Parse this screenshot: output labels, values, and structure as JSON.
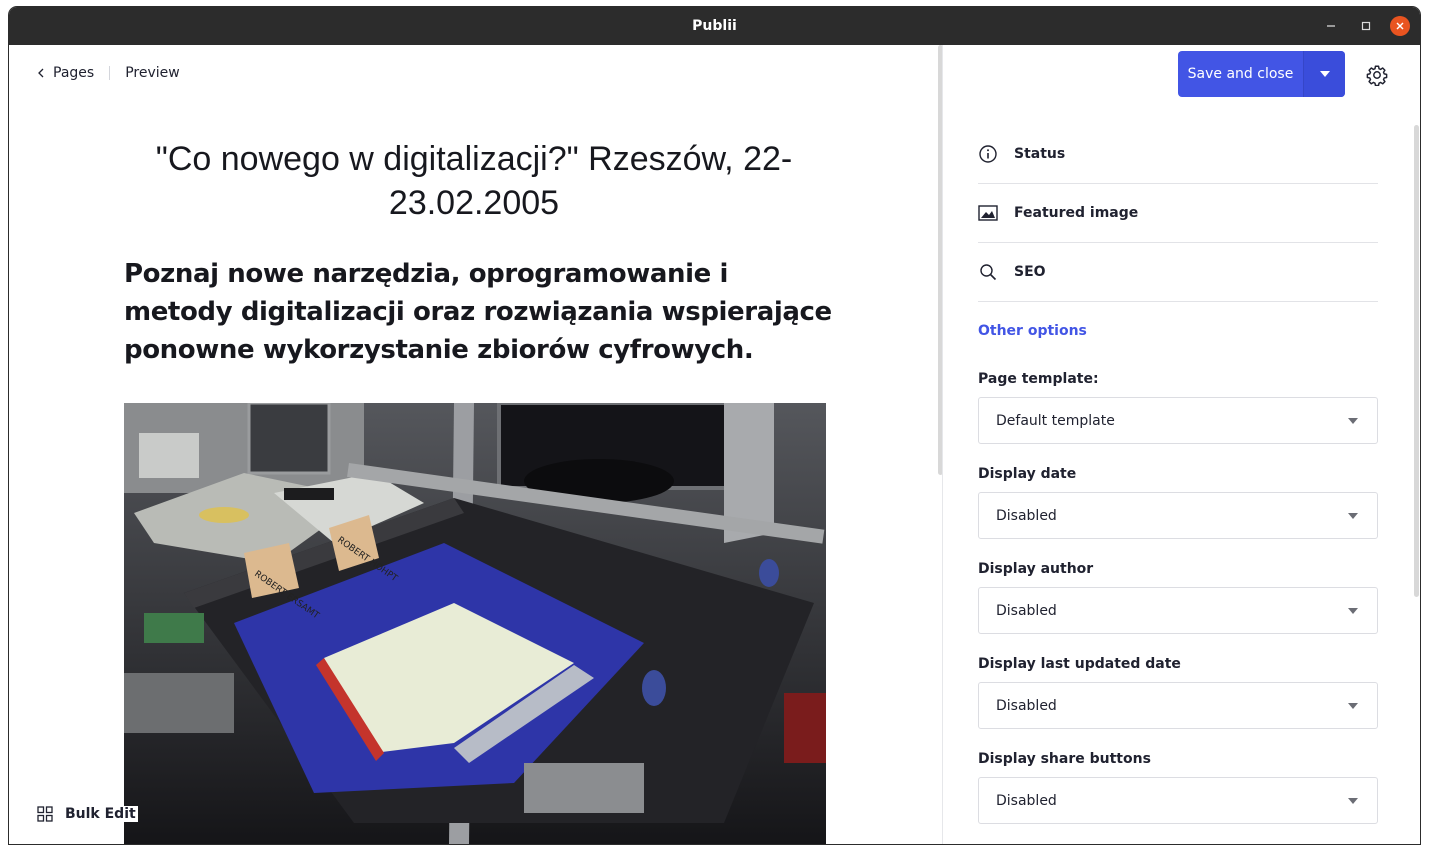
{
  "window": {
    "title": "Publii"
  },
  "nav": {
    "back_label": "Pages",
    "preview_label": "Preview"
  },
  "content": {
    "title": "\"Co nowego w digitalizacji?\" Rzeszów, 22-23.02.2005",
    "lead": "Poznaj nowe narzędzia, oprogramowanie i metody digitalizacji oraz rozwiązania wspierające ponowne wykorzystanie zbiorów cyfrowych.",
    "photo_tags": [
      "ROBERT HOHPT",
      "ROBERT ERSAMT"
    ]
  },
  "bulk_edit": {
    "label": "Bulk Edit"
  },
  "sidebar": {
    "save_label": "Save and close",
    "sections": [
      {
        "label": "Status",
        "icon": "info-icon"
      },
      {
        "label": "Featured image",
        "icon": "image-icon"
      },
      {
        "label": "SEO",
        "icon": "search-icon"
      }
    ],
    "other_options": "Other options",
    "fields": [
      {
        "label": "Page template:",
        "value": "Default template"
      },
      {
        "label": "Display date",
        "value": "Disabled"
      },
      {
        "label": "Display author",
        "value": "Disabled"
      },
      {
        "label": "Display last updated date",
        "value": "Disabled"
      },
      {
        "label": "Display share buttons",
        "value": "Disabled"
      }
    ]
  },
  "colors": {
    "accent": "#4255e5",
    "titlebar": "#2c2c2c",
    "close": "#e95420"
  }
}
